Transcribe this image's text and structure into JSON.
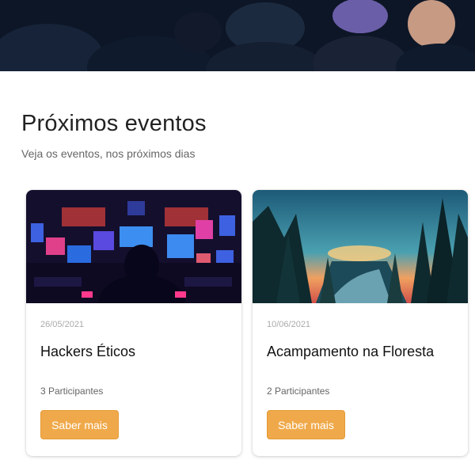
{
  "events_section": {
    "title": "Próximos eventos",
    "subtitle": "Veja os eventos, nos próximos dias"
  },
  "events": [
    {
      "date": "26/05/2021",
      "title": "Hackers Éticos",
      "participants": "3 Participantes",
      "button_label": "Saber mais",
      "image_icon": "hacker-illustration"
    },
    {
      "date": "10/06/2021",
      "title": "Acampamento na Floresta",
      "participants": "2 Participantes",
      "button_label": "Saber mais",
      "image_icon": "forest-sunset-illustration"
    }
  ],
  "colors": {
    "accent_button": "#f0a94a",
    "hero_dark": "#0b1424"
  }
}
